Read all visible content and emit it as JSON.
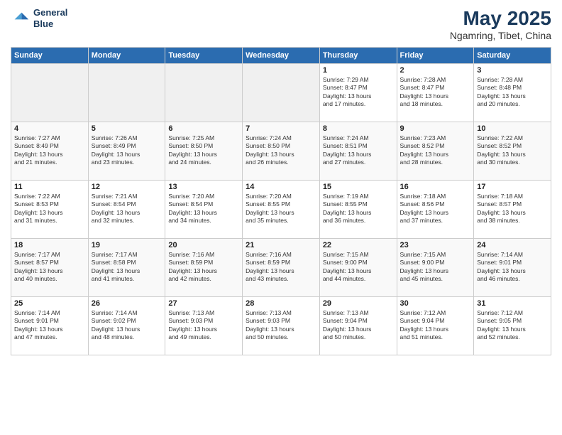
{
  "header": {
    "logo_line1": "General",
    "logo_line2": "Blue",
    "month_title": "May 2025",
    "location": "Ngamring, Tibet, China"
  },
  "days_of_week": [
    "Sunday",
    "Monday",
    "Tuesday",
    "Wednesday",
    "Thursday",
    "Friday",
    "Saturday"
  ],
  "weeks": [
    [
      {
        "day": "",
        "info": ""
      },
      {
        "day": "",
        "info": ""
      },
      {
        "day": "",
        "info": ""
      },
      {
        "day": "",
        "info": ""
      },
      {
        "day": "1",
        "info": "Sunrise: 7:29 AM\nSunset: 8:47 PM\nDaylight: 13 hours\nand 17 minutes."
      },
      {
        "day": "2",
        "info": "Sunrise: 7:28 AM\nSunset: 8:47 PM\nDaylight: 13 hours\nand 18 minutes."
      },
      {
        "day": "3",
        "info": "Sunrise: 7:28 AM\nSunset: 8:48 PM\nDaylight: 13 hours\nand 20 minutes."
      }
    ],
    [
      {
        "day": "4",
        "info": "Sunrise: 7:27 AM\nSunset: 8:49 PM\nDaylight: 13 hours\nand 21 minutes."
      },
      {
        "day": "5",
        "info": "Sunrise: 7:26 AM\nSunset: 8:49 PM\nDaylight: 13 hours\nand 23 minutes."
      },
      {
        "day": "6",
        "info": "Sunrise: 7:25 AM\nSunset: 8:50 PM\nDaylight: 13 hours\nand 24 minutes."
      },
      {
        "day": "7",
        "info": "Sunrise: 7:24 AM\nSunset: 8:50 PM\nDaylight: 13 hours\nand 26 minutes."
      },
      {
        "day": "8",
        "info": "Sunrise: 7:24 AM\nSunset: 8:51 PM\nDaylight: 13 hours\nand 27 minutes."
      },
      {
        "day": "9",
        "info": "Sunrise: 7:23 AM\nSunset: 8:52 PM\nDaylight: 13 hours\nand 28 minutes."
      },
      {
        "day": "10",
        "info": "Sunrise: 7:22 AM\nSunset: 8:52 PM\nDaylight: 13 hours\nand 30 minutes."
      }
    ],
    [
      {
        "day": "11",
        "info": "Sunrise: 7:22 AM\nSunset: 8:53 PM\nDaylight: 13 hours\nand 31 minutes."
      },
      {
        "day": "12",
        "info": "Sunrise: 7:21 AM\nSunset: 8:54 PM\nDaylight: 13 hours\nand 32 minutes."
      },
      {
        "day": "13",
        "info": "Sunrise: 7:20 AM\nSunset: 8:54 PM\nDaylight: 13 hours\nand 34 minutes."
      },
      {
        "day": "14",
        "info": "Sunrise: 7:20 AM\nSunset: 8:55 PM\nDaylight: 13 hours\nand 35 minutes."
      },
      {
        "day": "15",
        "info": "Sunrise: 7:19 AM\nSunset: 8:55 PM\nDaylight: 13 hours\nand 36 minutes."
      },
      {
        "day": "16",
        "info": "Sunrise: 7:18 AM\nSunset: 8:56 PM\nDaylight: 13 hours\nand 37 minutes."
      },
      {
        "day": "17",
        "info": "Sunrise: 7:18 AM\nSunset: 8:57 PM\nDaylight: 13 hours\nand 38 minutes."
      }
    ],
    [
      {
        "day": "18",
        "info": "Sunrise: 7:17 AM\nSunset: 8:57 PM\nDaylight: 13 hours\nand 40 minutes."
      },
      {
        "day": "19",
        "info": "Sunrise: 7:17 AM\nSunset: 8:58 PM\nDaylight: 13 hours\nand 41 minutes."
      },
      {
        "day": "20",
        "info": "Sunrise: 7:16 AM\nSunset: 8:59 PM\nDaylight: 13 hours\nand 42 minutes."
      },
      {
        "day": "21",
        "info": "Sunrise: 7:16 AM\nSunset: 8:59 PM\nDaylight: 13 hours\nand 43 minutes."
      },
      {
        "day": "22",
        "info": "Sunrise: 7:15 AM\nSunset: 9:00 PM\nDaylight: 13 hours\nand 44 minutes."
      },
      {
        "day": "23",
        "info": "Sunrise: 7:15 AM\nSunset: 9:00 PM\nDaylight: 13 hours\nand 45 minutes."
      },
      {
        "day": "24",
        "info": "Sunrise: 7:14 AM\nSunset: 9:01 PM\nDaylight: 13 hours\nand 46 minutes."
      }
    ],
    [
      {
        "day": "25",
        "info": "Sunrise: 7:14 AM\nSunset: 9:01 PM\nDaylight: 13 hours\nand 47 minutes."
      },
      {
        "day": "26",
        "info": "Sunrise: 7:14 AM\nSunset: 9:02 PM\nDaylight: 13 hours\nand 48 minutes."
      },
      {
        "day": "27",
        "info": "Sunrise: 7:13 AM\nSunset: 9:03 PM\nDaylight: 13 hours\nand 49 minutes."
      },
      {
        "day": "28",
        "info": "Sunrise: 7:13 AM\nSunset: 9:03 PM\nDaylight: 13 hours\nand 50 minutes."
      },
      {
        "day": "29",
        "info": "Sunrise: 7:13 AM\nSunset: 9:04 PM\nDaylight: 13 hours\nand 50 minutes."
      },
      {
        "day": "30",
        "info": "Sunrise: 7:12 AM\nSunset: 9:04 PM\nDaylight: 13 hours\nand 51 minutes."
      },
      {
        "day": "31",
        "info": "Sunrise: 7:12 AM\nSunset: 9:05 PM\nDaylight: 13 hours\nand 52 minutes."
      }
    ]
  ]
}
